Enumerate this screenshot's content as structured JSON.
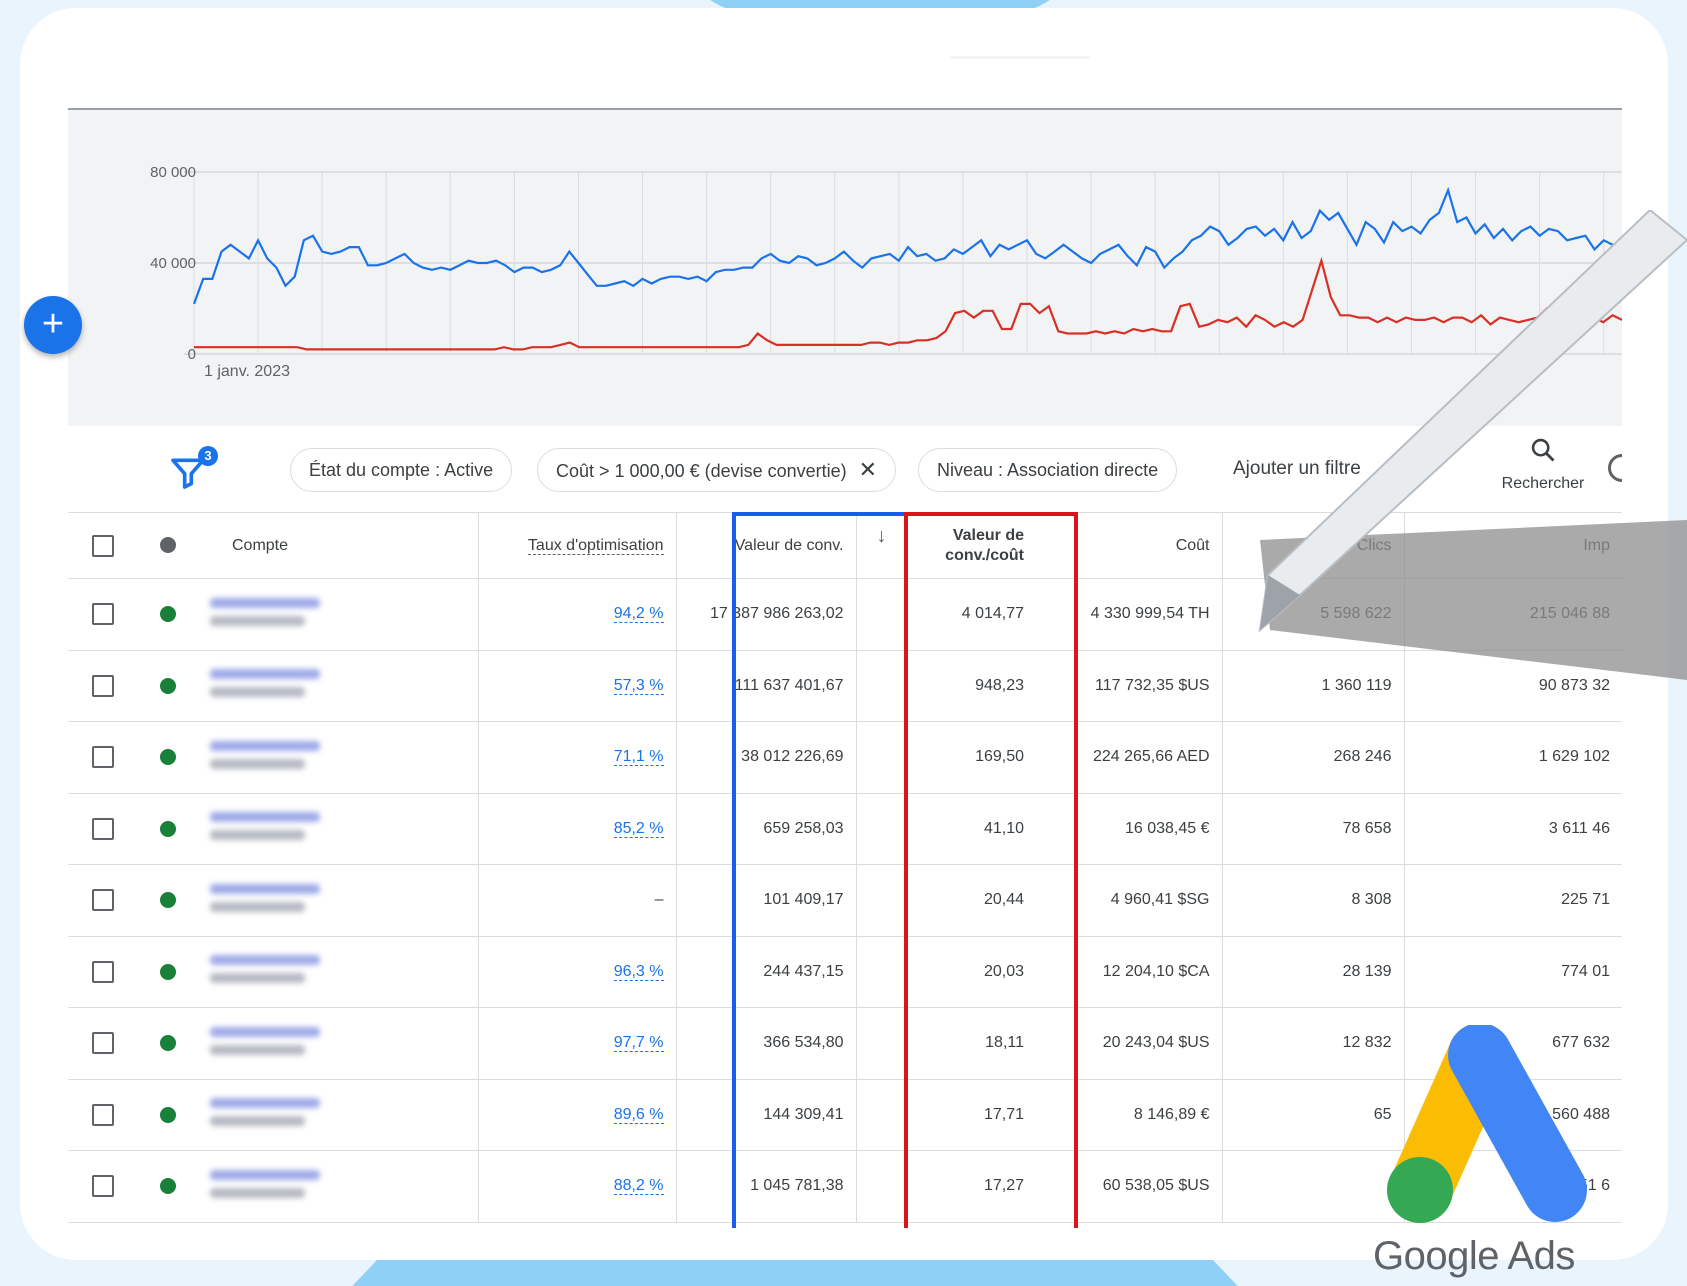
{
  "colors": {
    "blue_series": "#1a73e8",
    "red_series": "#d93025",
    "highlight_blue": "#1a5de8",
    "highlight_red": "#d9141d",
    "status_active": "#188038"
  },
  "chart": {
    "y_ticks": [
      "80 000",
      "40 000",
      "0"
    ],
    "x_start_label": "1 janv. 2023"
  },
  "chart_data": {
    "type": "line",
    "x_start": "1 janv. 2023",
    "ylim": [
      0,
      80000
    ],
    "grid": true,
    "series": [
      {
        "color": "#1a73e8",
        "values": [
          22000,
          33000,
          33000,
          45000,
          48000,
          45000,
          42000,
          50000,
          42000,
          38000,
          30000,
          34000,
          50000,
          52000,
          45000,
          44000,
          45000,
          47000,
          47000,
          39000,
          39000,
          40000,
          42000,
          44000,
          40000,
          38000,
          37000,
          38000,
          37000,
          39000,
          41000,
          40000,
          40000,
          41000,
          39000,
          36000,
          38000,
          38000,
          36000,
          37000,
          39000,
          45000,
          40000,
          35000,
          30000,
          30000,
          31000,
          32000,
          30000,
          33000,
          31000,
          33000,
          34000,
          34000,
          33000,
          34000,
          32000,
          36000,
          37000,
          37000,
          38000,
          38000,
          42000,
          44000,
          41000,
          40000,
          43000,
          42000,
          39000,
          40000,
          42000,
          45000,
          41000,
          38000,
          42000,
          43000,
          44000,
          41000,
          47000,
          43000,
          44000,
          41000,
          42000,
          46000,
          44000,
          47000,
          50000,
          43000,
          48000,
          46000,
          48000,
          50000,
          44000,
          42000,
          45000,
          48000,
          45000,
          42000,
          40000,
          44000,
          46000,
          48000,
          43000,
          39000,
          47000,
          45000,
          38000,
          42000,
          45000,
          50000,
          52000,
          56000,
          54000,
          48000,
          51000,
          55000,
          56000,
          52000,
          55000,
          50000,
          58000,
          51000,
          54000,
          63000,
          59000,
          62000,
          55000,
          48000,
          58000,
          55000,
          49000,
          58000,
          54000,
          56000,
          53000,
          59000,
          62000,
          72000,
          58000,
          60000,
          53000,
          57000,
          51000,
          55000,
          50000,
          54000,
          56000,
          52000,
          55000,
          54000,
          50000,
          51000,
          52000,
          46000,
          50000,
          48000,
          47000
        ]
      },
      {
        "color": "#d93025",
        "values": [
          3000,
          3000,
          3000,
          3000,
          3000,
          3000,
          3000,
          3000,
          3000,
          3000,
          3000,
          3000,
          2000,
          2000,
          2000,
          2000,
          2000,
          2000,
          2000,
          2000,
          2000,
          2000,
          2000,
          2000,
          2000,
          2000,
          2000,
          2000,
          2000,
          2000,
          2000,
          2000,
          2000,
          3000,
          2000,
          2000,
          3000,
          3000,
          3000,
          4000,
          5000,
          3000,
          3000,
          3000,
          3000,
          3000,
          3000,
          3000,
          3000,
          3000,
          3000,
          3000,
          3000,
          3000,
          3000,
          3000,
          3000,
          3000,
          3000,
          4000,
          9000,
          6000,
          4000,
          4000,
          4000,
          4000,
          4000,
          4000,
          4000,
          4000,
          4000,
          4000,
          5000,
          5000,
          4000,
          5000,
          5000,
          6000,
          6000,
          7000,
          10000,
          18000,
          19000,
          16000,
          19000,
          19000,
          11000,
          11000,
          22000,
          22000,
          18000,
          21000,
          10000,
          9000,
          9000,
          9000,
          10000,
          9000,
          10000,
          9000,
          11000,
          10000,
          11000,
          10000,
          10000,
          21000,
          22000,
          12000,
          13000,
          15000,
          14000,
          16000,
          12000,
          17000,
          15000,
          12000,
          14000,
          12000,
          15000,
          28000,
          41000,
          25000,
          17000,
          17000,
          16000,
          16000,
          14000,
          16000,
          14000,
          16000,
          15000,
          15000,
          16000,
          14000,
          16000,
          16000,
          14000,
          17000,
          13000,
          16000,
          15000,
          14000,
          15000,
          16000,
          20000,
          15000,
          17000,
          16000,
          20000,
          16000,
          14000,
          17000,
          15000
        ]
      }
    ]
  },
  "filters": {
    "badge": "3",
    "chips": [
      {
        "label": "État du compte : Active",
        "removable": false
      },
      {
        "label": "Coût > 1 000,00 € (devise convertie)",
        "removable": true
      },
      {
        "label": "Niveau : Association directe",
        "removable": false
      }
    ],
    "add_filter": "Ajouter un filtre",
    "search_label": "Rechercher",
    "close_glyph": "✕"
  },
  "table": {
    "headers": {
      "compte": "Compte",
      "taux": "Taux d'optimisation",
      "valeur": "Valeur de conv.",
      "sort_arrow": "↓",
      "ratio_line1": "Valeur de",
      "ratio_line2": "conv./coût",
      "cout": "Coût",
      "clics": "Clics",
      "imp": "Imp"
    },
    "rows": [
      {
        "taux": "94,2 %",
        "valeur": "17 387 986 263,02",
        "ratio": "4 014,77",
        "cout": "4 330 999,54 TH",
        "clics": "5 598 622",
        "imp": "215 046 88",
        "fade": false
      },
      {
        "taux": "57,3 %",
        "valeur": "111 637 401,67",
        "ratio": "948,23",
        "cout": "117 732,35 $US",
        "clics": "1 360 119",
        "imp": "90 873 32",
        "fade": false
      },
      {
        "taux": "71,1 %",
        "valeur": "38 012 226,69",
        "ratio": "169,50",
        "cout": "224 265,66 AED",
        "clics": "268 246",
        "imp": "1 629 102",
        "fade": false
      },
      {
        "taux": "85,2 %",
        "valeur": "659 258,03",
        "ratio": "41,10",
        "cout": "16 038,45 €",
        "clics": "78 658",
        "imp": "3 611 46",
        "fade": false
      },
      {
        "taux": "–",
        "valeur": "101 409,17",
        "ratio": "20,44",
        "cout": "4 960,41 $SG",
        "clics": "8 308",
        "imp": "225 71",
        "fade": false
      },
      {
        "taux": "96,3 %",
        "valeur": "244 437,15",
        "ratio": "20,03",
        "cout": "12 204,10 $CA",
        "clics": "28 139",
        "imp": "774 01",
        "fade": true
      },
      {
        "taux": "97,7 %",
        "valeur": "366 534,80",
        "ratio": "18,11",
        "cout": "20 243,04 $US",
        "clics": "12 832",
        "imp": "677 632",
        "fade": true
      },
      {
        "taux": "89,6 %",
        "valeur": "144 309,41",
        "ratio": "17,71",
        "cout": "8 146,89 €",
        "clics": "65",
        "imp": "560 488",
        "fade": true
      },
      {
        "taux": "88,2 %",
        "valeur": "1 045 781,38",
        "ratio": "17,27",
        "cout": "60 538,05 $US",
        "clics": "",
        "imp": "851 6",
        "fade": true
      }
    ]
  },
  "brand": {
    "logo_text": "Google Ads"
  }
}
